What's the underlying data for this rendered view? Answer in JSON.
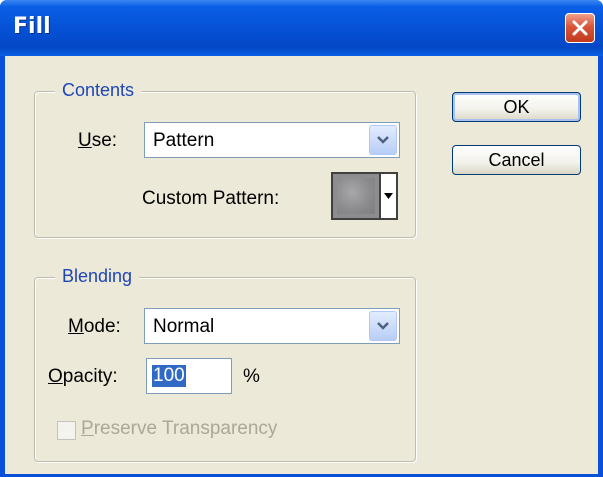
{
  "window": {
    "title": "Fill"
  },
  "contents": {
    "legend": "Contents",
    "use_label_u": "U",
    "use_label_rest": "se:",
    "use_value": "Pattern",
    "custom_pattern_label": "Custom Pattern:"
  },
  "blending": {
    "legend": "Blending",
    "mode_label_u": "M",
    "mode_label_rest": "ode:",
    "mode_value": "Normal",
    "opacity_label_u": "O",
    "opacity_label_rest": "pacity:",
    "opacity_value": "100",
    "opacity_unit": "%",
    "preserve_u": "P",
    "preserve_rest": "reserve Transparency",
    "preserve_checked": false,
    "preserve_enabled": false
  },
  "buttons": {
    "ok": "OK",
    "cancel": "Cancel"
  },
  "icons": {
    "close": "close-icon",
    "combo_arrow": "chevron-down-icon",
    "pattern_arrow": "caret-down-icon"
  },
  "colors": {
    "titlebar": "#0550d4",
    "legend_text": "#1e46b4",
    "dialog_bg": "#ece9d8",
    "close_button": "#d8553a",
    "selection": "#316ac5"
  }
}
